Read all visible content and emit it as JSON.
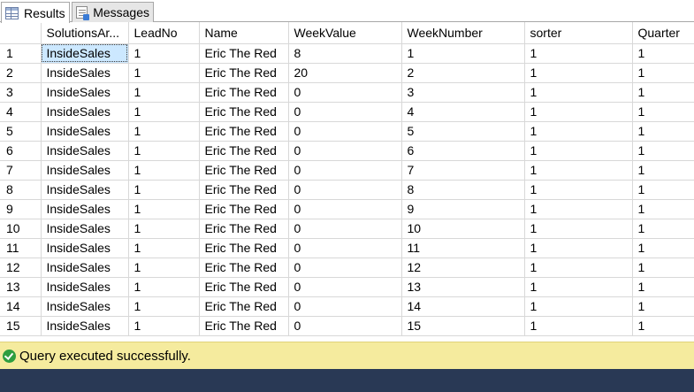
{
  "tabs": {
    "results_label": "Results",
    "messages_label": "Messages"
  },
  "grid": {
    "columns": [
      "",
      "SolutionsAr...",
      "LeadNo",
      "Name",
      "WeekValue",
      "WeekNumber",
      "sorter",
      "Quarter"
    ],
    "rows": [
      [
        "1",
        "InsideSales",
        "1",
        "Eric The Red",
        "8",
        "1",
        "1",
        "1"
      ],
      [
        "2",
        "InsideSales",
        "1",
        "Eric The Red",
        "20",
        "2",
        "1",
        "1"
      ],
      [
        "3",
        "InsideSales",
        "1",
        "Eric The Red",
        "0",
        "3",
        "1",
        "1"
      ],
      [
        "4",
        "InsideSales",
        "1",
        "Eric The Red",
        "0",
        "4",
        "1",
        "1"
      ],
      [
        "5",
        "InsideSales",
        "1",
        "Eric The Red",
        "0",
        "5",
        "1",
        "1"
      ],
      [
        "6",
        "InsideSales",
        "1",
        "Eric The Red",
        "0",
        "6",
        "1",
        "1"
      ],
      [
        "7",
        "InsideSales",
        "1",
        "Eric The Red",
        "0",
        "7",
        "1",
        "1"
      ],
      [
        "8",
        "InsideSales",
        "1",
        "Eric The Red",
        "0",
        "8",
        "1",
        "1"
      ],
      [
        "9",
        "InsideSales",
        "1",
        "Eric The Red",
        "0",
        "9",
        "1",
        "1"
      ],
      [
        "10",
        "InsideSales",
        "1",
        "Eric The Red",
        "0",
        "10",
        "1",
        "1"
      ],
      [
        "11",
        "InsideSales",
        "1",
        "Eric The Red",
        "0",
        "11",
        "1",
        "1"
      ],
      [
        "12",
        "InsideSales",
        "1",
        "Eric The Red",
        "0",
        "12",
        "1",
        "1"
      ],
      [
        "13",
        "InsideSales",
        "1",
        "Eric The Red",
        "0",
        "13",
        "1",
        "1"
      ],
      [
        "14",
        "InsideSales",
        "1",
        "Eric The Red",
        "0",
        "14",
        "1",
        "1"
      ],
      [
        "15",
        "InsideSales",
        "1",
        "Eric The Red",
        "0",
        "15",
        "1",
        "1"
      ]
    ],
    "selected_cell_color": "#cce8ff"
  },
  "status": {
    "message": "Query executed successfully.",
    "icon": "success-check-icon",
    "background": "#f5eb9e"
  },
  "colors": {
    "footer": "#293955"
  }
}
